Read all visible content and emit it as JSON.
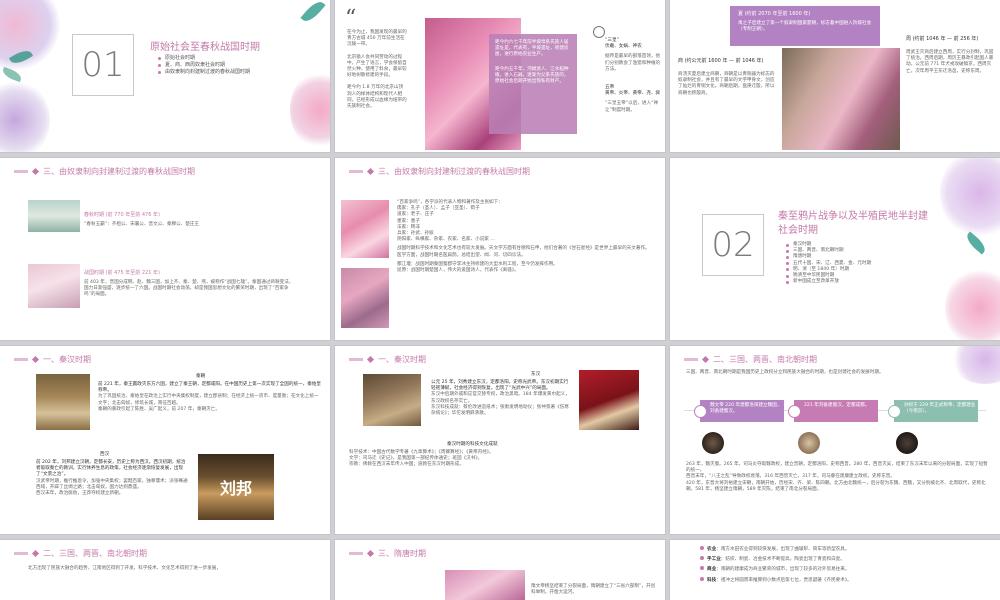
{
  "s1": {
    "num": "01",
    "title": "原始社会至春秋战国时期",
    "bullets": [
      "原始社会时期",
      "夏、商、西周奴隶社会时期",
      "由奴隶制向封建制过渡的春秋战国时期"
    ]
  },
  "s2": {
    "quote_mark": "“",
    "left_text": "在今为止，我国发现的最早的青方古城 450 万年前生活在沅陵一带。",
    "left_text2": "北京猿人会共同劳动的过程中，产生了语言，学会保留自然火种，使用了料食，最早较好地树敬修建的手段。",
    "left_text3": "距今约 1.8 万年的北京山顶洞人的样体结构和现代人相同，已经形成以血缘为纽带的氏族制社会。",
    "overlay_text": "距今约六七千年前半坡母系氏族人居遗址是，代表有，半坡遗址，修建房屋，进行原始农业生产。",
    "overlay_text2": "距今约五千年，河姆渡人、江水稻种植，进入石器，逐渐为父系氏族的，原始社会后期开始出现私有财产。",
    "right_label1": "“三皇”",
    "right_sub1": "伏羲、女娲、神农",
    "right_text1": "据传是最早的部落首领，他们分别教会了渔猎和种植的方法。",
    "right_label2": "五帝",
    "right_sub2": "黄帝、炎帝、黄帝、尧、舜",
    "right_text2": "“三皇五帝”以后，进入“禅让”制度时期。"
  },
  "s3": {
    "banner_title": "夏 (约前 2070 年至前 1600 年)",
    "banner_text": "禹之子启建立了第一个奴隶制国家夏朝，标志着中国进入阶级社会（专制王朝）。",
    "shang_title": "商 (约公元前 1600 年 — 前 1046 年)",
    "shang_text": "商汤灭夏后建立商朝，商朝是以青铜器为标志的奴隶制社会，并且有了最早的文字甲骨文，创造了灿烂的青铜文化。商朝后期，盘庚迁殷，所以商朝也称殷商。",
    "zhou_title": "周 (约前 1046 年 — 前 256 年)",
    "zhou_text": "周武王灭商后建立西周，实行分封制，巩固了统治。西周后期，周厉王暴政引起国人暴动。公元前 771 年犬戎攻破镐京，西周灭亡。次年周平王东迁洛邑，史称东周。"
  },
  "s4": {
    "header": "三、由奴隶制向封建制过渡的春秋战国时期",
    "spring_title": "春秋时期 (前 770 年至前 476 年)",
    "spring_text": "“春秋五霸”：齐桓公、宋襄公、晋文公、秦穆公、楚庄王",
    "warring_title": "战国时期 (前 475 年至前 221 年)",
    "warring_text": "前 403 年，晋国分成韩、赵、魏三国，加上齐、秦、楚、燕，被称作“战国七雄”。秦国通过商鞅变法，国力日渐强盛，逐步统一了六国。战国时期社会动荡，却是我国思想文化的繁荣时期，出现了“百家争鸣”的局面。"
  },
  "s5": {
    "header": "三、由奴隶制向封建制过渡的春秋战国时期",
    "text1": "“百家争鸣”，各学派的代表人物和著作及主张如下：",
    "text2": "儒家：孔子（圣人）、孟子（亚圣）、荀子",
    "text3": "道家：老子、庄子",
    "text4": "墨家：墨子",
    "text5": "法家：韩非",
    "text6": "兵家：孙武、孙膑",
    "text7": "阴阳家、纵横家、杂家、农家、名家、小说家 …",
    "text8": "战国时期科学技术和文化艺术也有较大发展。天文学方面有甘德和石申，他们合著的《甘石星经》是世界上最早的天文著作。",
    "text9": "医学方面，战国时期名医扁鹊，总结出望、闻、问、切四诊法。",
    "text10": "都江堰：战国时期秦国蜀郡守李冰主持修建的大型水利工程，至今仍发挥作用。",
    "text11": "屈原：战国时期楚国人，伟大的爱国诗人，代表作《离骚》。"
  },
  "s6": {
    "num": "02",
    "title": "秦至鸦片战争以及半殖民地半封建社会时期",
    "bullets": [
      "秦汉时期",
      "三国、两晋、南北朝时期",
      "隋唐时期",
      "五代十国、宋、辽、西夏、金、元时期",
      "明、清（至 1840 年）时期",
      "晚清至中华民国时期",
      "新中国成立至改革开放"
    ]
  },
  "s7": {
    "header": "一、秦汉时期",
    "label1": "秦朝",
    "text1": "前 221 年，秦王嬴政灭东方六国，建立了秦王朝，定都咸阳。在中国历史上第一次实现了全国的统一，秦始皇称帝。",
    "text2": "为了巩固统治，秦始皇在政治上实行中央集权制度，建立郡县制；在经济上统一货币、度量衡；在文化上统一文字；北击匈奴，修筑长城，南征百越。",
    "text3": "秦朝的暴政引起了陈胜、吴广起义，前 207 年，秦朝灭亡。",
    "label2": "西汉",
    "text4": "前 202 年，刘邦建立汉朝，定都长安，历史上称为西汉。西汉初期，统治者吸取秦亡的教训，实行休养生息的政策，社会经济逐渐恢复发展，出现了“文景之治”。",
    "text5": "汉武帝时期，推行推恩令，加强中央集权；罢黜百家，独尊儒术；派张骞通西域，开辟了丝绸之路；北击匈奴，国力达到鼎盛。",
    "text6": "西汉末年，政治腐败，王莽夺权建立新朝。",
    "portrait_text": "刘邦"
  },
  "s8": {
    "header": "一、秦汉时期",
    "label1": "东汉",
    "text1": "公元 25 年，刘秀建立东汉，定都洛阳，史称光武帝。东汉初期实行轻徭薄赋，社会经济得到恢复，出现了“光武中兴”的局面。",
    "text2": "东汉中后期外戚和宦官交替专权，政治黑暗。184 年爆发黄巾起义，东汉政权名存实亡。",
    "text3": "东汉科技成就：蔡伦改进造纸术；张衡发明地动仪；张仲景著《伤寒杂病论》；华佗发明麻沸散。",
    "sub_title": "秦汉时期的科技文化成就",
    "text4": "科学技术：中国古代数学专著《九章算术》；《周髀算经》；《黄帝内经》。",
    "text5": "文学：司马迁《史记》，是我国第一部纪传体通史；班固《汉书》。",
    "text6": "宗教：佛教在西汉末年传入中国；道教在东汉时期形成。"
  },
  "s9": {
    "header": "二、三国、两晋、南北朝时期",
    "intro": "三国、两晋、南北朝时期是我国历史上政权分立和民族大融合的时期，也是封建社会的发展时期。",
    "card1": "魏文帝 220 年建都洛阳建立魏国，刘备建蜀汉。",
    "card2": "221 年刘备建蜀汉，定都成都。",
    "card3": "孙权于 229 年正式称帝，定都建业（今南京）。",
    "text1": "263 年，魏灭蜀。265 年，司马炎夺取魏政权，建立晋朝，定都洛阳，史称西晋。280 年，西晋灭吴，结束了东汉末年以来的分裂局面，实现了短暂的统一。",
    "text2": "西晋末年，“八王之乱”导致政权衰落，316 年西晋灭亡。317 年，司马睿在建康建立政权，史称东晋。",
    "text3": "420 年，东晋大将刘裕建立宋朝，南朝开始，历经宋、齐、梁、陈四朝。北方由北魏统一，后分裂为东魏、西魏，又分别被北齐、北周取代，史称北朝。581 年，杨坚建立隋朝，589 年灭陈，结束了南北分裂局面。"
  },
  "s10": {
    "header": "二、三国、两晋、南北朝时期",
    "intro": "北方出现了民族大融合的趋势，江南地区得到了开发，科学技术、文化艺术得到了进一步发展，"
  },
  "s11": {
    "header": "三、隋唐时期",
    "text": "隋文帝杨坚结束了分裂局面，隋朝建立了“三省六部制”，开创科举制，开凿大运河。"
  },
  "s12": {
    "bullets": [
      {
        "label": "农业",
        "text": "南方水田农业得到较快发展，出现了曲辕犁、筒车等新型农具。"
      },
      {
        "label": "手工业",
        "text": "纺织、制瓷、冶金技术不断提高，陶瓷出现了青瓷和白瓷。"
      },
      {
        "label": "商业",
        "text": "南朝的建康成为商业繁荣的城市，出现了较多的对外贸易往来。"
      },
      {
        "label": "科技",
        "text": "祖冲之将圆周率推算到小数点后第七位，贾思勰著《齐民要术》。"
      }
    ]
  }
}
